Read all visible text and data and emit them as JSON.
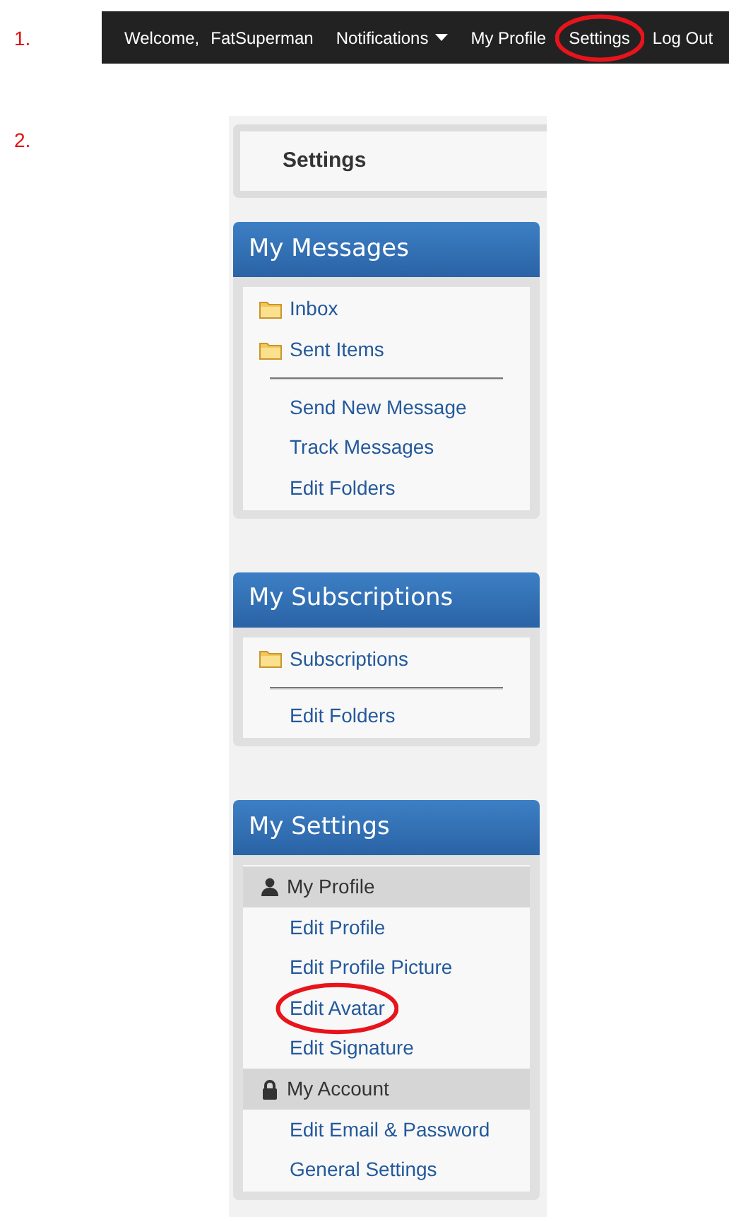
{
  "steps": [
    {
      "label": "1."
    },
    {
      "label": "2."
    }
  ],
  "topbar": {
    "items": [
      {
        "kind": "text",
        "label": "Welcome,",
        "circled": false
      },
      {
        "kind": "text",
        "label": "FatSuperman",
        "circled": false
      },
      {
        "kind": "dropdown",
        "label": "Notifications",
        "circled": false
      },
      {
        "kind": "link",
        "label": "My Profile",
        "circled": false
      },
      {
        "kind": "link",
        "label": "Settings",
        "circled": true
      },
      {
        "kind": "link",
        "label": "Log Out",
        "circled": false
      }
    ]
  },
  "page_title": "Settings",
  "panels": [
    {
      "title": "My Messages",
      "items": [
        {
          "kind": "folder",
          "label": "Inbox",
          "circled": false
        },
        {
          "kind": "folder",
          "label": "Sent Items",
          "circled": false
        },
        {
          "kind": "divider"
        },
        {
          "kind": "link",
          "label": "Send New Message",
          "circled": false
        },
        {
          "kind": "link",
          "label": "Track Messages",
          "circled": false
        },
        {
          "kind": "link",
          "label": "Edit Folders",
          "circled": false
        }
      ]
    },
    {
      "title": "My Subscriptions",
      "items": [
        {
          "kind": "folder",
          "label": "Subscriptions",
          "circled": false
        },
        {
          "kind": "divider"
        },
        {
          "kind": "link",
          "label": "Edit Folders",
          "circled": false
        }
      ]
    },
    {
      "title": "My Settings",
      "items": [
        {
          "kind": "profile_section",
          "label": "My Profile"
        },
        {
          "kind": "link",
          "label": "Edit Profile",
          "circled": false
        },
        {
          "kind": "link",
          "label": "Edit Profile Picture",
          "circled": false
        },
        {
          "kind": "link",
          "label": "Edit Avatar",
          "circled": true
        },
        {
          "kind": "link",
          "label": "Edit Signature",
          "circled": false
        },
        {
          "kind": "account_section",
          "label": "My Account"
        },
        {
          "kind": "link",
          "label": "Edit Email & Password",
          "circled": false
        },
        {
          "kind": "link",
          "label": "General Settings",
          "circled": false
        }
      ]
    }
  ]
}
